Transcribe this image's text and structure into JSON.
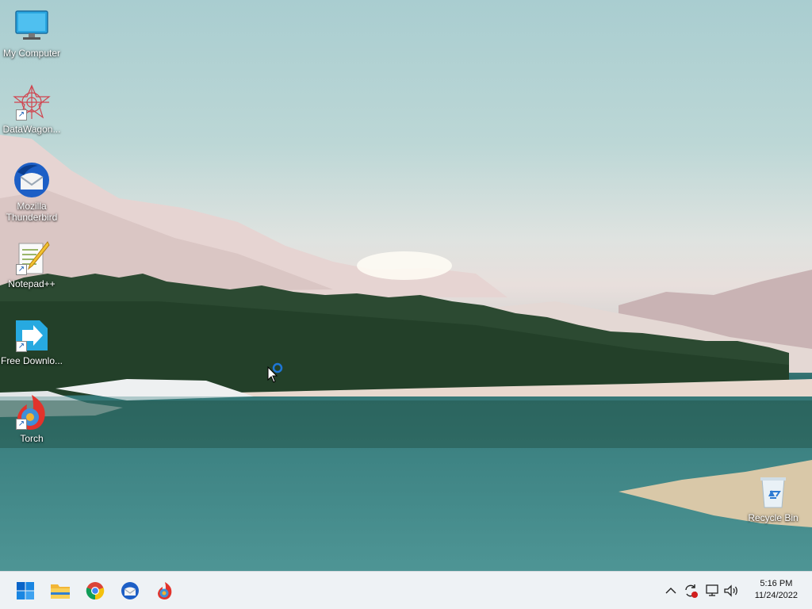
{
  "desktop": {
    "icons": [
      {
        "label": "My Computer",
        "icon": "monitor-icon"
      },
      {
        "label": "DataWagon...",
        "icon": "datawagon-icon"
      },
      {
        "label": "Mozilla Thunderbird",
        "icon": "thunderbird-icon"
      },
      {
        "label": "Notepad++",
        "icon": "notepad-plus-plus-icon"
      },
      {
        "label": "Free Downlo...",
        "icon": "free-download-manager-icon"
      },
      {
        "label": "Torch",
        "icon": "torch-browser-icon"
      }
    ],
    "recycle_bin": {
      "label": "Recycle Bin",
      "icon": "recycle-bin-icon"
    }
  },
  "taskbar": {
    "pinned": [
      {
        "name": "Start",
        "icon": "windows-start-icon"
      },
      {
        "name": "File Explorer",
        "icon": "folder-icon"
      },
      {
        "name": "Google Chrome",
        "icon": "chrome-icon"
      },
      {
        "name": "Mozilla Thunderbird",
        "icon": "thunderbird-icon"
      },
      {
        "name": "Torch",
        "icon": "torch-browser-icon"
      }
    ],
    "tray": {
      "icons": [
        "chevron-up-icon",
        "sync-icon",
        "network-icon",
        "volume-icon"
      ]
    },
    "clock": {
      "time": "5:16 PM",
      "date": "11/24/2022"
    }
  },
  "colors": {
    "taskbar_bg": "#eef2f5",
    "accent": "#0078d4"
  }
}
